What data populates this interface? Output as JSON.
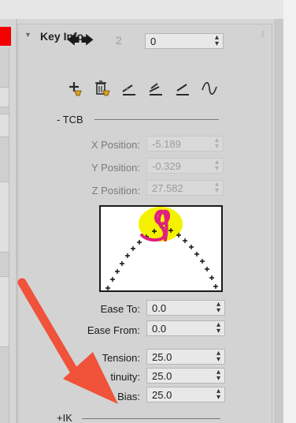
{
  "rollout": {
    "title": "Key Info"
  },
  "key_nav": {
    "prev_icon": "arrow-left-icon",
    "next_icon": "arrow-right-icon",
    "key_number": "2",
    "track_value": "0"
  },
  "toolbar": {
    "icons": [
      "set-key-icon",
      "delete-key-icon",
      "tangent-slow-icon",
      "tangent-step-icon",
      "tangent-linear-icon",
      "tangent-smooth-icon"
    ]
  },
  "tcb": {
    "group_label": "- TCB",
    "x_label": "X Position:",
    "x_value": "-5.189",
    "y_label": "Y Position:",
    "y_value": "-0.329",
    "z_label": "Z Position:",
    "z_value": "27.582",
    "ease_to_label": "Ease To:",
    "ease_to_value": "0.0",
    "ease_from_label": "Ease From:",
    "ease_from_value": "0.0",
    "tension_label": "Tension:",
    "tension_value": "25.0",
    "continuity_label": "tinuity:",
    "continuity_value": "25.0",
    "bias_label": "Bias:",
    "bias_value": "25.0"
  },
  "ik": {
    "group_label": "+IK"
  },
  "colors": {
    "annotation_red": "#f0523a",
    "highlight_yellow": "#f4f200",
    "scribble_magenta": "#e0207e",
    "swatch_red": "#f20000"
  }
}
